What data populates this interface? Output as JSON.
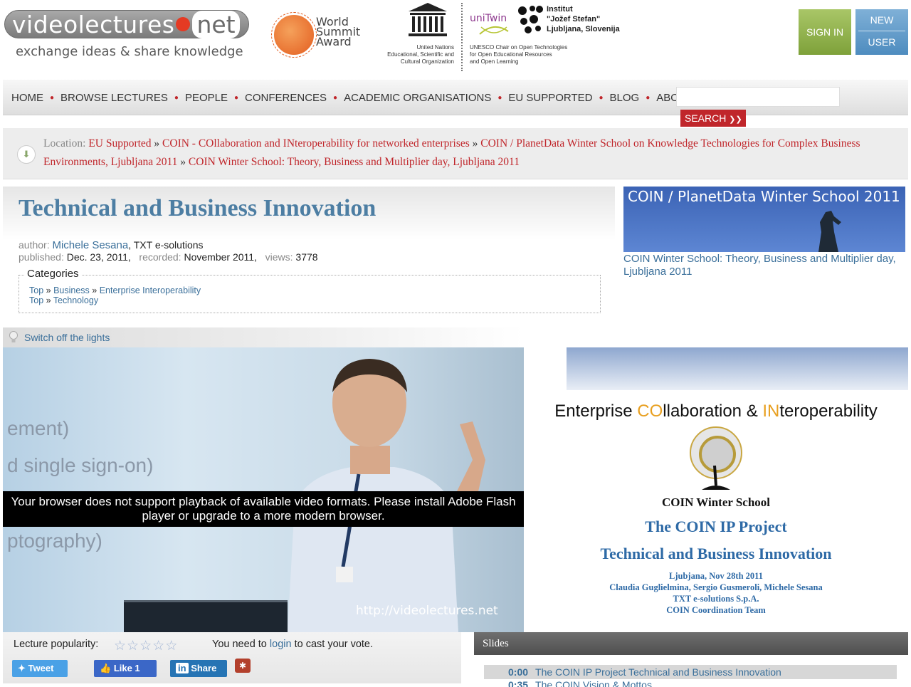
{
  "header": {
    "logo_left": "videolectures",
    "logo_right": "net",
    "tagline": "exchange ideas & share knowledge",
    "wsa_lines": [
      "World",
      "Summit",
      "Award"
    ],
    "unesco_lines": [
      "United Nations",
      "Educational, Scientific and",
      "Cultural Organization"
    ],
    "unitwin": "uniTwin",
    "unitwin_lines": [
      "UNESCO Chair on Open Technologies",
      "for Open Educational Resources",
      "and Open Learning"
    ],
    "ijs_lines": [
      "Institut",
      "\"Jožef Stefan\"",
      "Ljubljana, Slovenija"
    ],
    "sign_in": "SIGN IN",
    "new_user": [
      "NEW",
      "USER"
    ]
  },
  "nav": {
    "items": [
      "HOME",
      "BROWSE LECTURES",
      "PEOPLE",
      "CONFERENCES",
      "ACADEMIC ORGANISATIONS",
      "EU SUPPORTED",
      "BLOG",
      "ABOUT US"
    ],
    "search_label": "SEARCH",
    "search_placeholder": ""
  },
  "breadcrumb": {
    "label": "Location:",
    "items": [
      "EU Supported",
      "COIN - COllaboration and INteroperability for networked enterprises",
      "COIN / PlanetData Winter School on Knowledge Technologies for Complex Business Environments, Ljubljana 2011",
      "COIN Winter School: Theory, Business and Multiplier day, Ljubljana 2011"
    ],
    "separator": "»"
  },
  "lecture": {
    "title": "Technical and Business Innovation",
    "author_label": "author:",
    "author": "Michele Sesana",
    "affiliation": ", TXT e-solutions",
    "published_label": "published:",
    "published": "Dec. 23, 2011,",
    "recorded_label": "recorded:",
    "recorded": "November 2011,",
    "views_label": "views:",
    "views": "3778"
  },
  "categories": {
    "title": "Categories",
    "rows": [
      [
        "Top",
        "Business",
        "Enterprise Interoperability"
      ],
      [
        "Top",
        "Technology"
      ]
    ]
  },
  "event": {
    "banner": "COIN / PlanetData Winter School 2011",
    "link": "COIN Winter School: Theory, Business and Multiplier day, Ljubljana 2011"
  },
  "lights": "Switch off the lights",
  "video": {
    "message": "Your browser does not support playback of available video formats. Please install Adobe Flash player or upgrade to a more modern browser.",
    "watermark": "http://videolectures.net",
    "slide_words": [
      "ement)",
      "d single sign-on)",
      "ptography)"
    ]
  },
  "slide_preview": {
    "heading_parts": [
      "Enterprise ",
      "CO",
      "llaboration & ",
      "IN",
      "teroperability"
    ],
    "school": "COIN Winter School",
    "project": "The COIN IP Project",
    "title": "Technical and Business Innovation",
    "lines": [
      "Ljubjana, Nov 28th 2011",
      "Claudia Guglielmina, Sergio Gusmeroli, Michele Sesana",
      "TXT e-solutions S.p.A.",
      "COIN Coordination Team"
    ]
  },
  "rating": {
    "label": "Lecture popularity:",
    "stars_total": 5,
    "stars_filled": 0,
    "vote_prefix": "You need to",
    "vote_link": "login",
    "vote_suffix": "to cast your vote."
  },
  "share": {
    "tweet": "Tweet",
    "like": "Like 1",
    "linkedin": "Share"
  },
  "slides": {
    "heading": "Slides",
    "rows": [
      {
        "time": "0:00",
        "title": "The COIN IP Project Technical and Business Innovation"
      },
      {
        "time": "0:35",
        "title": "The COIN Vision & Mottos"
      }
    ]
  }
}
